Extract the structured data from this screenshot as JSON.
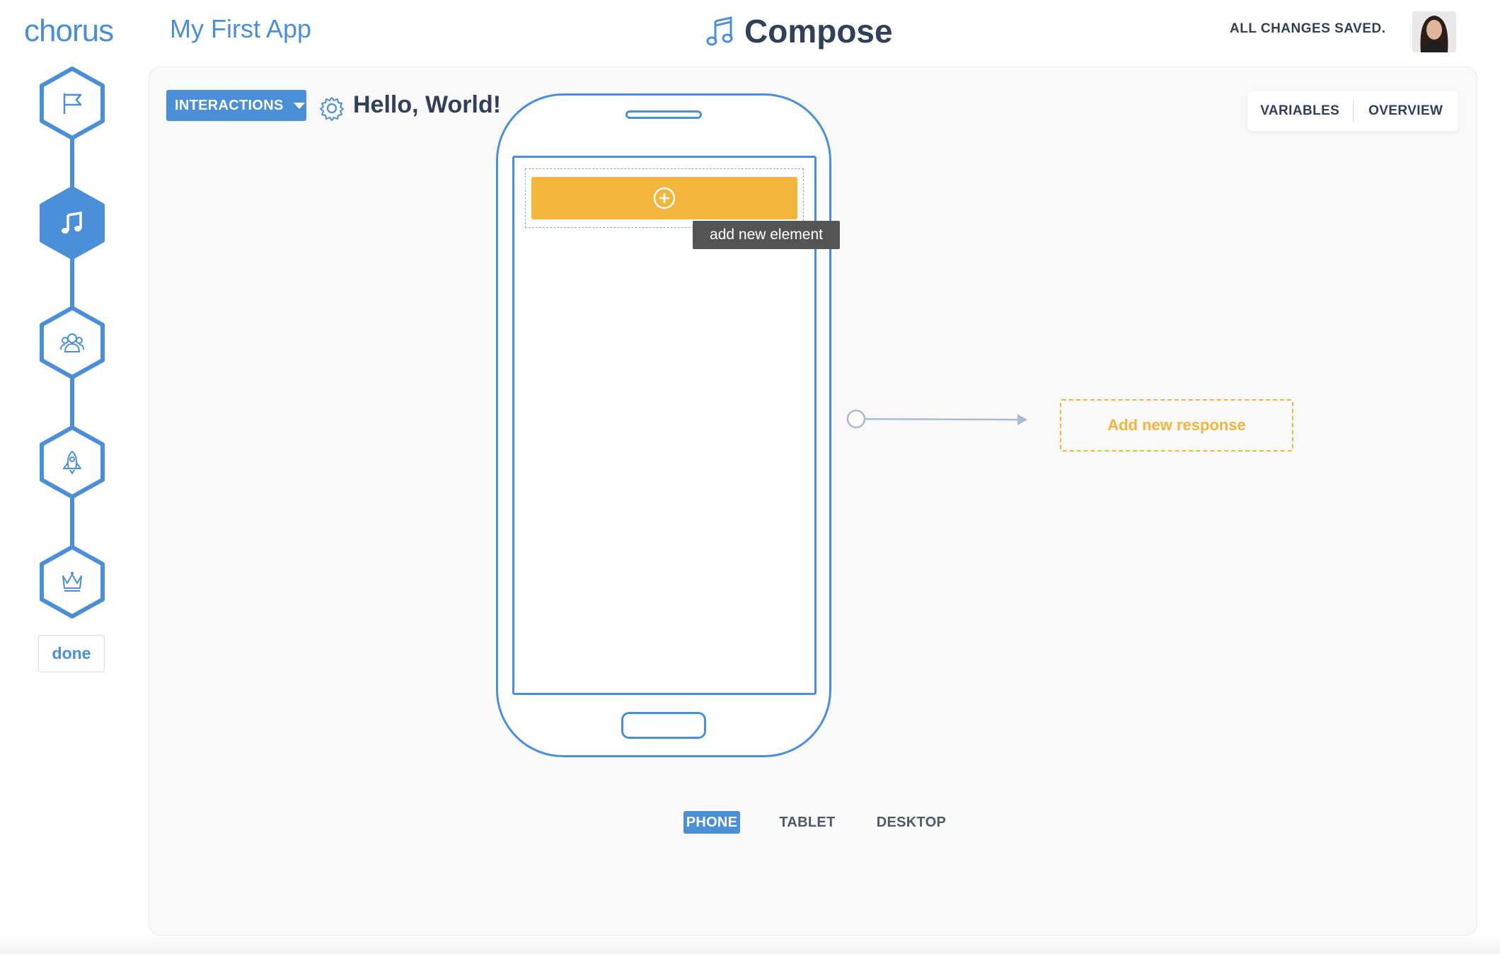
{
  "header": {
    "logo_text": "chorus",
    "app_name": "My First App",
    "page_title": "Compose",
    "save_status": "ALL CHANGES SAVED."
  },
  "steps": [
    {
      "icon": "flag-icon",
      "active": false
    },
    {
      "icon": "music-note-icon",
      "active": true
    },
    {
      "icon": "users-icon",
      "active": false
    },
    {
      "icon": "rocket-icon",
      "active": false
    },
    {
      "icon": "crown-icon",
      "active": false
    }
  ],
  "done_label": "done",
  "toolbar": {
    "interactions_label": "INTERACTIONS",
    "interaction_title": "Hello, World!"
  },
  "view_tabs": {
    "variables": "VARIABLES",
    "overview": "OVERVIEW"
  },
  "canvas": {
    "tooltip": "add new element",
    "add_response": "Add new response"
  },
  "device_tabs": {
    "phone": "PHONE",
    "tablet": "TABLET",
    "desktop": "DESKTOP",
    "selected": "PHONE"
  },
  "colors": {
    "primary": "#4a8fd8",
    "accent": "#f4b53d",
    "text": "#2f4058"
  }
}
